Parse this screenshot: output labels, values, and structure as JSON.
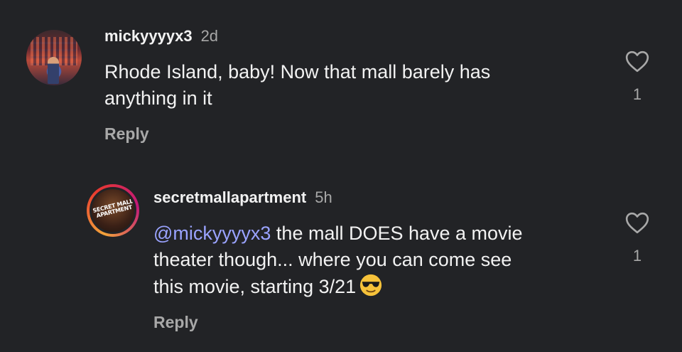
{
  "comments": [
    {
      "username": "mickyyyyx3",
      "time": "2d",
      "text": "Rhode Island, baby! Now that mall barely has anything in it",
      "text_line1": "Rhode Island, baby! Now that mall barely has",
      "text_line2": "anything in it",
      "reply_label": "Reply",
      "like_count": "1",
      "avatar_icon": "profile-photo"
    },
    {
      "username": "secretmallapartment",
      "time": "5h",
      "mention": "@mickyyyyx3",
      "text_line1_rest": " the mall DOES have a movie",
      "text_line2": "theater though... where you can come see",
      "text_line3": "this movie, starting 3/21",
      "emoji": "smiling-face-with-sunglasses",
      "reply_label": "Reply",
      "like_count": "1",
      "avatar_logo_text": "SECRET MALL APARTMENT"
    }
  ],
  "colors": {
    "background": "#222326",
    "text": "#f2f2f2",
    "muted": "#a8a8a8",
    "mention": "#9aa3ff"
  }
}
